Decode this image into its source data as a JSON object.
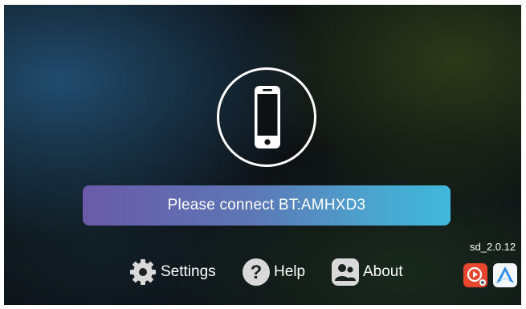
{
  "connect": {
    "message": "Please connect BT:AMHXD3",
    "phone_icon": "smartphone-icon"
  },
  "version": "sd_2.0.12",
  "menu": [
    {
      "label": "Settings",
      "icon": "gear-icon"
    },
    {
      "label": "Help",
      "icon": "question-icon"
    },
    {
      "label": "About",
      "icon": "people-icon"
    }
  ],
  "apps": [
    {
      "icon": "carplay-icon",
      "color": "#e8472f"
    },
    {
      "icon": "android-auto-icon",
      "color": "#2d8ce6"
    }
  ],
  "colors": {
    "banner_start": "#6a5aa8",
    "banner_end": "#3fb8dc",
    "background": "#0d1114"
  }
}
